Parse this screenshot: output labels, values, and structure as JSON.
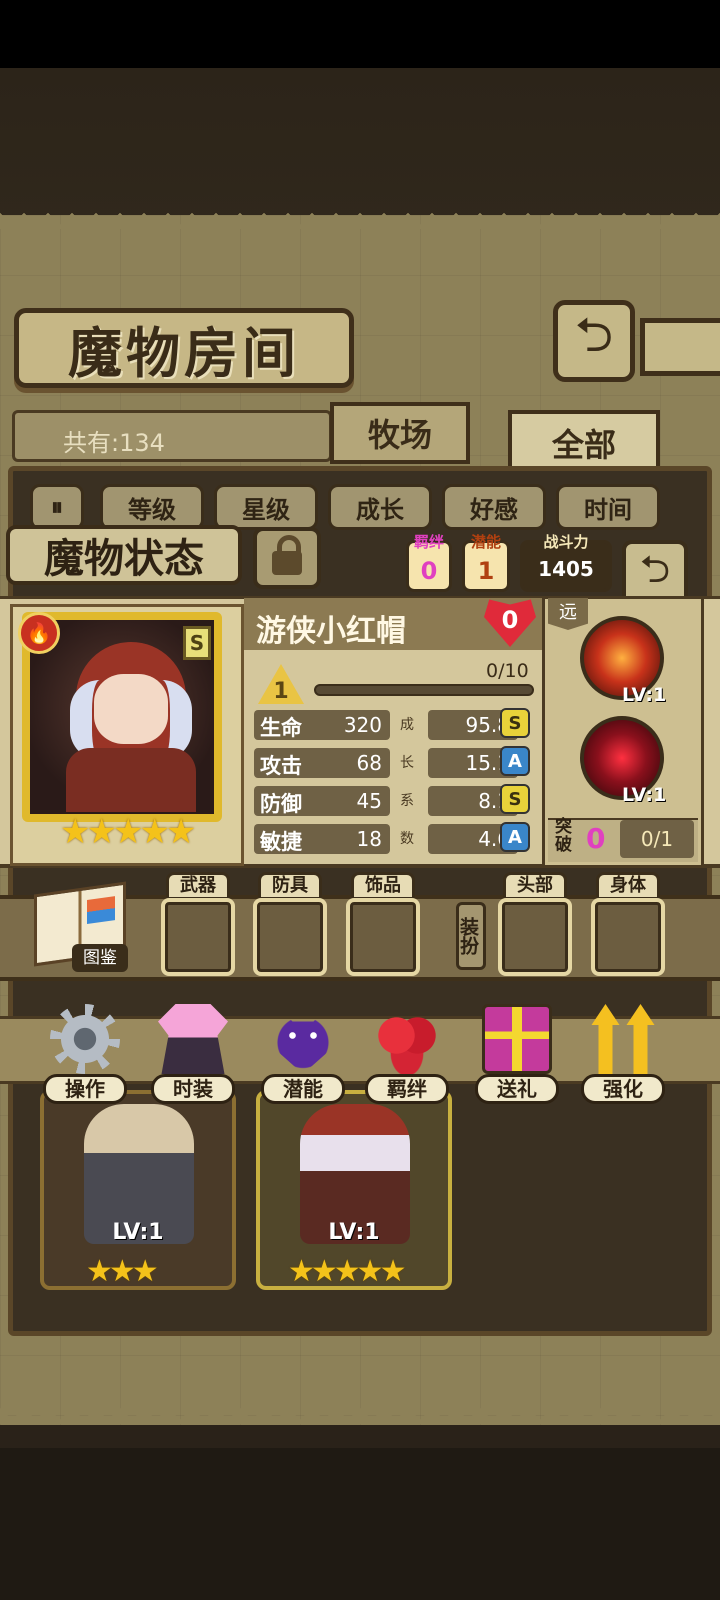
{
  "room": {
    "title": "魔物房间",
    "count_label": "共有:134",
    "tabs": [
      "牧场",
      "全部"
    ],
    "filters": [
      "等级",
      "星级",
      "成长",
      "好感",
      "时间"
    ]
  },
  "status": {
    "title": "魔物状态",
    "bond_label": "羁绊",
    "bond_value": "0",
    "potential_label": "潜能",
    "potential_value": "1",
    "power_label": "战斗力",
    "power_value": "1405",
    "name": "游侠小红帽",
    "affection": "0",
    "rank_badge": "S",
    "level": "1",
    "exp_text": "0/10",
    "exp_fraction": 0.0,
    "stars": "★★★★★",
    "stats": [
      {
        "key": "生命",
        "value": "320",
        "growth": "95.8",
        "grade": "S"
      },
      {
        "key": "攻击",
        "value": "68",
        "growth": "15.1",
        "grade": "A"
      },
      {
        "key": "防御",
        "value": "45",
        "growth": "8.1",
        "grade": "S"
      },
      {
        "key": "敏捷",
        "value": "18",
        "growth": "4.6",
        "grade": "A"
      }
    ],
    "growth_chars": [
      "成",
      "长",
      "系",
      "数"
    ],
    "range_tag": "远",
    "skills": [
      {
        "level": "LV:1"
      },
      {
        "level": "LV:1"
      }
    ],
    "breakthrough_label": "突破",
    "breakthrough_count": "0",
    "breakthrough_progress": "0/1"
  },
  "equipment": {
    "codex_label": "图鉴",
    "slots": [
      "武器",
      "防具",
      "饰品",
      "头部",
      "身体"
    ],
    "dress_up_label": "装扮"
  },
  "actions": [
    "操作",
    "时装",
    "潜能",
    "羁绊",
    "送礼",
    "强化"
  ],
  "cards": [
    {
      "level": "LV:1",
      "stars": "★★★"
    },
    {
      "level": "LV:1",
      "stars": "★★★★★"
    }
  ]
}
